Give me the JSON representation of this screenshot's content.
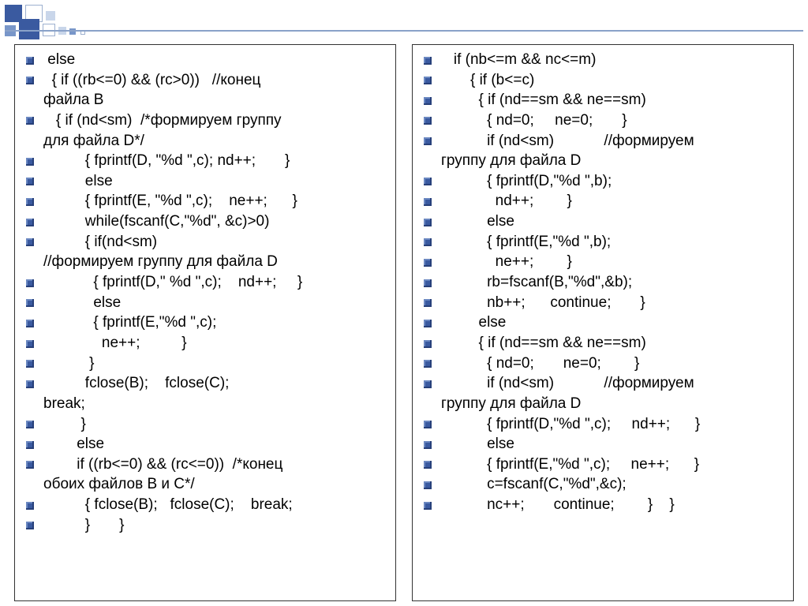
{
  "left": {
    "l1": " else",
    "l2a": "  { if ((rb<=0) && (rc>0))   //конец",
    "l2b": "файла B",
    "l3a": "   { if (nd<sm)  /*формируем группу",
    "l3b": "для файла D*/",
    "l4": "          { fprintf(D, \"%d \",c); nd++;       }",
    "l5": "          else",
    "l6": "          { fprintf(E, \"%d \",c);    ne++;      }",
    "l7": "          while(fscanf(C,\"%d\", &c)>0)",
    "l8a": "          { if(nd<sm)",
    "l8b": "//формируем группу для файла D",
    "l9": "            { fprintf(D,\" %d \",c);    nd++;     }",
    "l10": "            else",
    "l11": "            { fprintf(E,\"%d \",c);",
    "l12": "              ne++;          }",
    "l13": "           }",
    "l14a": "          fclose(B);    fclose(C);",
    "l14b": "break;",
    "l15": "         }",
    "l16": "        else",
    "l17a": "        if ((rb<=0) && (rc<=0))  /*конец",
    "l17b": "обоих файлов B и C*/",
    "l18": "          { fclose(B);   fclose(C);    break;",
    "l19": "          }       }"
  },
  "right": {
    "r1": "   if (nb<=m && nc<=m)",
    "r2": "       { if (b<=c)",
    "r3": "         { if (nd==sm && ne==sm)",
    "r4": "           { nd=0;     ne=0;       }",
    "r5a": "           if (nd<sm)            //формируем",
    "r5b": "группу для файла D",
    "r6": "           { fprintf(D,\"%d \",b);",
    "r7": "             nd++;        }",
    "r8": "           else",
    "r9": "           { fprintf(E,\"%d \",b);",
    "r10": "             ne++;        }",
    "r11": "           rb=fscanf(B,\"%d\",&b);",
    "r12": "           nb++;      continue;       }",
    "r13": "         else",
    "r14": "         { if (nd==sm && ne==sm)",
    "r15": "           { nd=0;       ne=0;        }",
    "r16a": "           if (nd<sm)            //формируем",
    "r16b": "группу для файла D",
    "r17": "           { fprintf(D,\"%d \",c);     nd++;      }",
    "r18": "           else",
    "r19": "           { fprintf(E,\"%d \",c);     ne++;      }",
    "r20": "           c=fscanf(C,\"%d\",&c);",
    "r21": "           nc++;       continue;        }    }"
  }
}
